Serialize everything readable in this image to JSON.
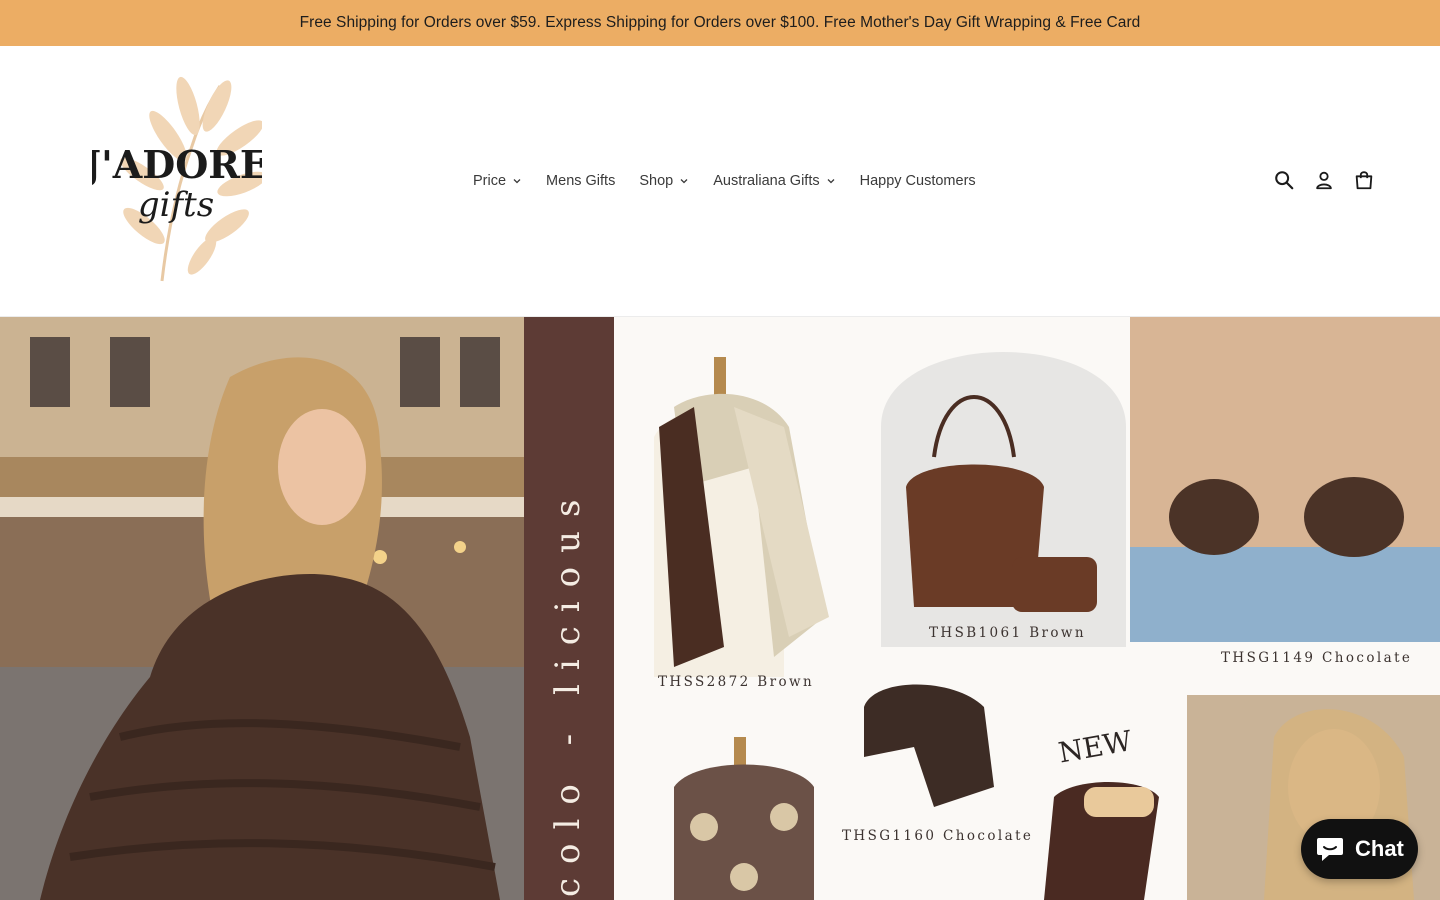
{
  "announcement": {
    "text": "Free Shipping for Orders over $59. Express Shipping for Orders over $100. Free Mother's Day Gift Wrapping & Free Card"
  },
  "header": {
    "logo": {
      "line1": "J'ADORE",
      "line2": "gifts",
      "icon": "leaf-logo"
    },
    "nav": [
      {
        "label": "Price",
        "has_dropdown": true
      },
      {
        "label": "Mens Gifts",
        "has_dropdown": false
      },
      {
        "label": "Shop",
        "has_dropdown": true
      },
      {
        "label": "Australiana Gifts",
        "has_dropdown": true
      },
      {
        "label": "Happy Customers",
        "has_dropdown": false
      }
    ],
    "icons": {
      "search": "search-icon",
      "account": "account-icon",
      "cart": "cart-icon"
    }
  },
  "hero": {
    "vertical_text": "colo - licious",
    "badge": "NEW",
    "products": [
      {
        "code": "THSS2872 Brown"
      },
      {
        "code": "THSB1061 Brown"
      },
      {
        "code": "THSG1149 Chocolate"
      },
      {
        "code": "THSG1160 Chocolate"
      }
    ]
  },
  "chat": {
    "label": "Chat",
    "icon": "chat-bubble-icon"
  },
  "colors": {
    "announcement_bg": "#ecad64",
    "strip": "#5d3b35",
    "chat_bg": "#111111"
  }
}
